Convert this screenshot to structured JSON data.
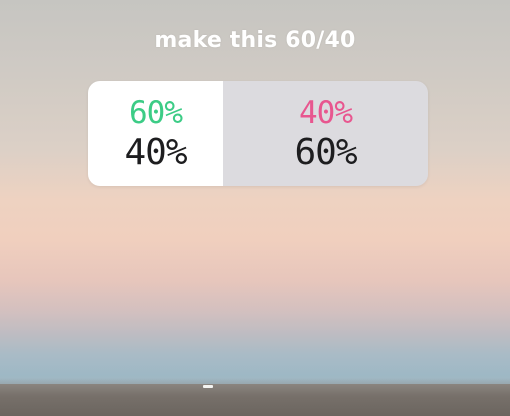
{
  "story": {
    "caption": "make this 60/40"
  },
  "poll": {
    "left_option": {
      "top_value": "60%",
      "bottom_value": "40%",
      "top_color": "#3ccc86"
    },
    "right_option": {
      "top_value": "40%",
      "bottom_value": "60%",
      "top_color": "#e8568f"
    }
  }
}
